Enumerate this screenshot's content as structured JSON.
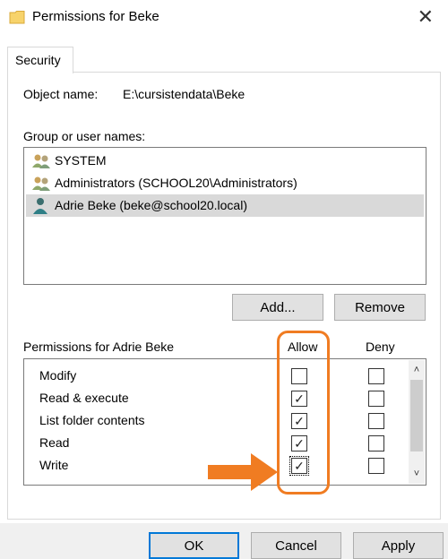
{
  "window": {
    "title": "Permissions for Beke",
    "close_glyph": "✕",
    "icon": "folder-icon"
  },
  "tabs": [
    {
      "label": "Security"
    }
  ],
  "object": {
    "label": "Object name:",
    "value": "E:\\cursistendata\\Beke"
  },
  "groups": {
    "label": "Group or user names:",
    "items": [
      {
        "name": "SYSTEM",
        "icon": "group-users-icon",
        "selected": false
      },
      {
        "name": "Administrators (SCHOOL20\\Administrators)",
        "icon": "group-users-icon",
        "selected": false
      },
      {
        "name": "Adrie Beke (beke@school20.local)",
        "icon": "user-icon",
        "selected": true
      }
    ],
    "add_label": "Add...",
    "remove_label": "Remove"
  },
  "permissions": {
    "header": "Permissions for Adrie Beke",
    "allow_label": "Allow",
    "deny_label": "Deny",
    "rows": [
      {
        "name": "Modify",
        "allow": false,
        "deny": false
      },
      {
        "name": "Read & execute",
        "allow": true,
        "deny": false
      },
      {
        "name": "List folder contents",
        "allow": true,
        "deny": false
      },
      {
        "name": "Read",
        "allow": true,
        "deny": false
      },
      {
        "name": "Write",
        "allow": true,
        "deny": false
      }
    ],
    "check_glyph": "✓",
    "scroll_up_glyph": "˄",
    "scroll_down_glyph": "˅"
  },
  "annotations": {
    "highlight_color": "#f07c22"
  },
  "footer": {
    "ok_label": "OK",
    "cancel_label": "Cancel",
    "apply_label": "Apply"
  }
}
